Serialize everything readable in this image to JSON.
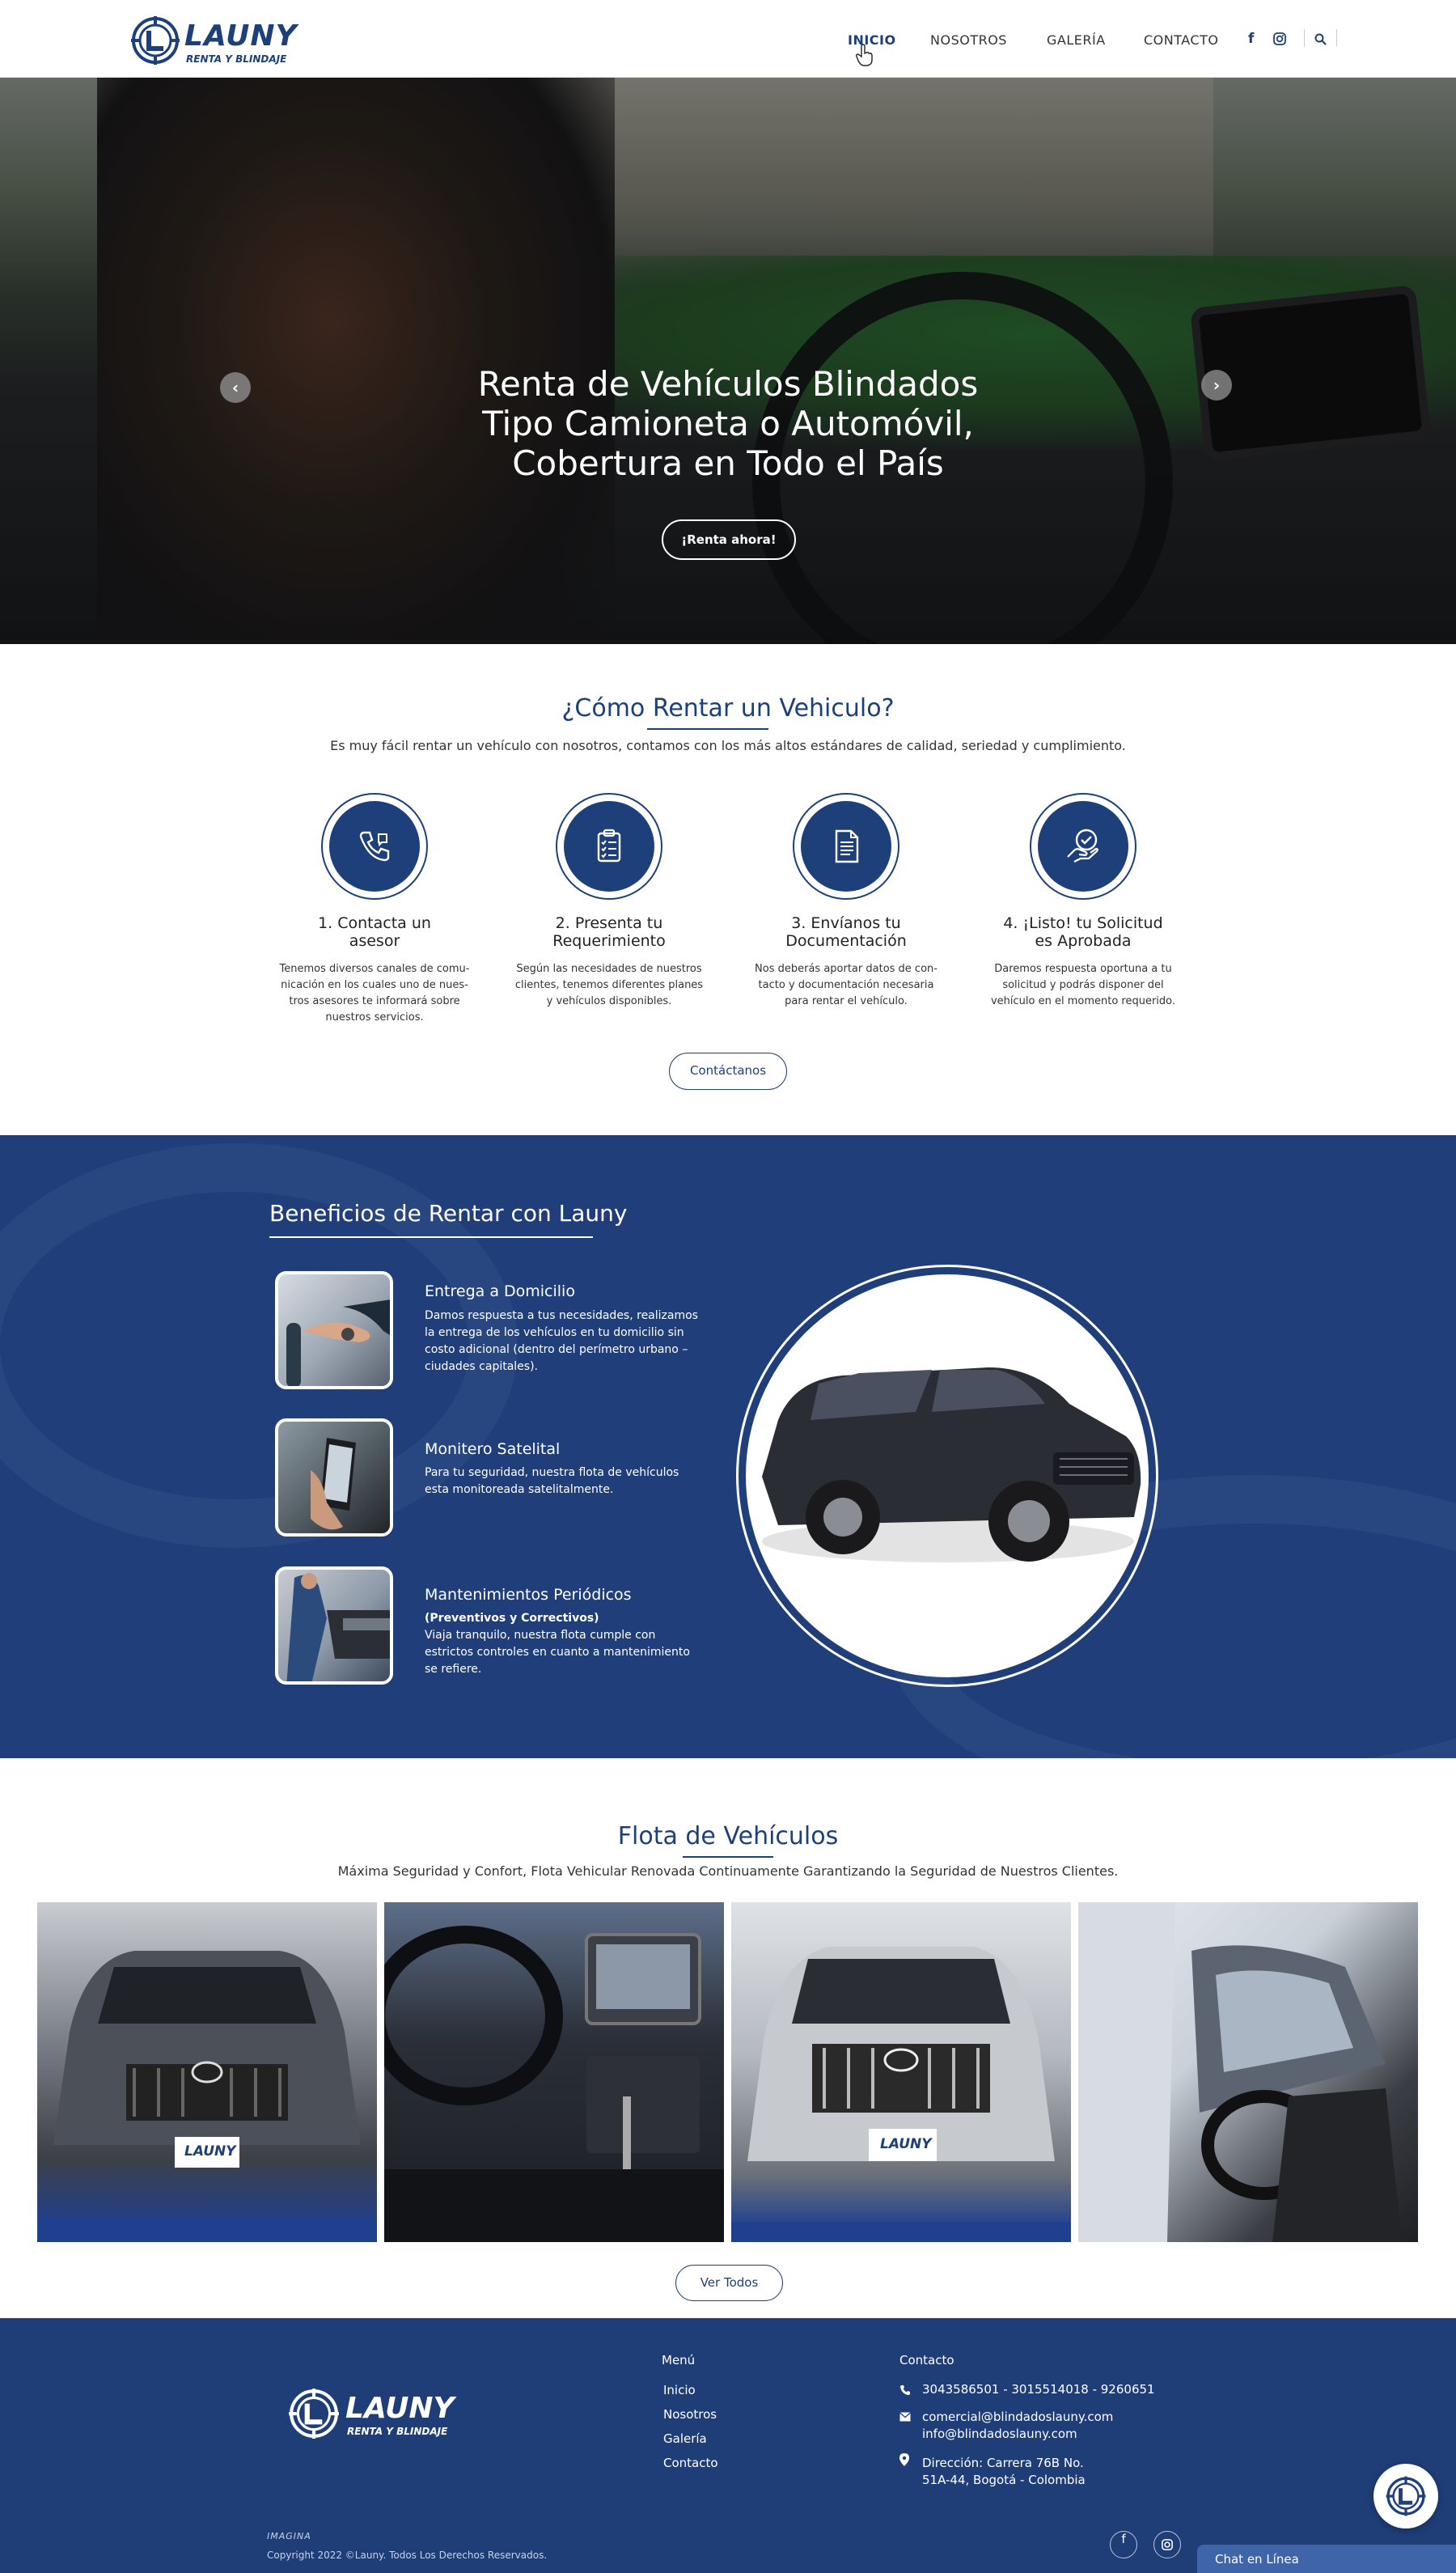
{
  "brand": {
    "name": "LAUNY",
    "tagline": "RENTA Y BLINDAJE",
    "primary_color": "#1d3f7a",
    "footer_color": "#1f3e78"
  },
  "nav": {
    "items": [
      "INICIO",
      "NOSOTROS",
      "GALERÍA",
      "CONTACTO"
    ],
    "active": "INICIO",
    "icons": [
      "facebook-icon",
      "instagram-icon",
      "search-icon"
    ]
  },
  "hero": {
    "title_lines": [
      "Renta de Vehículos Blindados",
      "Tipo Camioneta o Automóvil,",
      "Cobertura en Todo el País"
    ],
    "cta": "¡Renta ahora!",
    "prev_arrow": "‹",
    "next_arrow": "›"
  },
  "how": {
    "title": "¿Cómo Rentar un Vehiculo?",
    "subtitle": "Es muy fácil rentar un vehículo con nosotros, contamos con los más altos estándares de calidad, seriedad y cumplimiento.",
    "steps": [
      {
        "icon": "phone-icon",
        "title": "1. Contacta un\nasesor",
        "text": "Tenemos diversos canales de comu-\nnicación en los cuales uno de nues-\ntros asesores te informará sobre\nnuestros servicios."
      },
      {
        "icon": "clipboard-icon",
        "title": "2. Presenta tu\nRequerimiento",
        "text": "Según las necesidades de nuestros\nclientes, tenemos diferentes planes\ny vehículos disponibles."
      },
      {
        "icon": "document-icon",
        "title": "3. Envíanos tu\nDocumentación",
        "text": "Nos deberás aportar datos de con-\ntacto y documentación necesaria\npara rentar el vehículo."
      },
      {
        "icon": "approved-hand-icon",
        "title": "4. ¡Listo! tu Solicitud\nes Aprobada",
        "text": "Daremos respuesta oportuna a tu\nsolicitud y podrás disponer del\nvehículo en el momento requerido."
      }
    ],
    "cta": "Contáctanos"
  },
  "benefits": {
    "title": "Beneficios de Rentar con Launy",
    "items": [
      {
        "title": "Entrega a Domicilio",
        "emphasis": "",
        "text": "Damos respuesta a tus necesidades, realizamos la entrega de los vehículos en tu domicilio sin costo adicional (dentro del perímetro urbano – ciudades capitales)."
      },
      {
        "title": "Monitero Satelital",
        "emphasis": "",
        "text": "Para tu seguridad, nuestra flota de vehículos esta monitoreada satelitalmente."
      },
      {
        "title": "Mantenimientos Periódicos",
        "emphasis": "(Preventivos y Correctivos)",
        "text": "Viaja tranquilo, nuestra flota cumple con estrictos controles en cuanto a mantenimiento se refiere."
      }
    ]
  },
  "fleet": {
    "title": "Flota de Vehículos",
    "subtitle": "Máxima Seguridad y Confort, Flota Vehicular Renovada Continuamente Garantizando la Seguridad de Nuestros Clientes.",
    "plate_text": "LAUNY",
    "cta": "Ver Todos"
  },
  "footer": {
    "menu_title": "Menú",
    "menu": [
      "Inicio",
      "Nosotros",
      "Galería",
      "Contacto"
    ],
    "contact_title": "Contacto",
    "phones": "3043586501 - 3015514018 -  9260651",
    "emails": "comercial@blindadoslauny.com\ninfo@blindadoslauny.com",
    "address": "Dirección: Carrera 76B No.\n51A-44, Bogotá - Colombia",
    "credit_logo": "IMAGINA",
    "copyright": "Copyright 2022 ©Launy. Todos Los Derechos Reservados.",
    "chat": "Chat en Línea"
  }
}
